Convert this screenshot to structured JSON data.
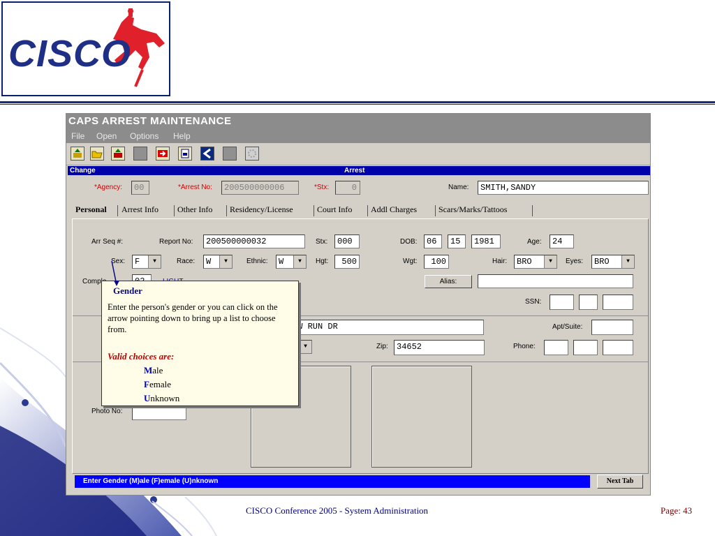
{
  "logo": {
    "text": "CISCO"
  },
  "window": {
    "title": "CAPS ARREST MAINTENANCE",
    "menu": [
      "File",
      "Open",
      "Options",
      "Help"
    ],
    "mode_left": "Change",
    "mode_right": "Arrest"
  },
  "header": {
    "agency_label": "*Agency:",
    "agency_value": "00",
    "arrest_no_label": "*Arrest No:",
    "arrest_no_value": "200500000006",
    "stx_label": "*Stx:",
    "stx_value": "0",
    "name_label": "Name:",
    "name_value": "SMITH,SANDY"
  },
  "tabs": [
    "Personal",
    "Arrest Info",
    "Other Info",
    "Residency/License",
    "Court Info",
    "Addl Charges",
    "Scars/Marks/Tattoos"
  ],
  "personal": {
    "arr_seq_label": "Arr Seq #:",
    "report_no_label": "Report No:",
    "report_no_value": "200500000032",
    "stx_label": "Stx:",
    "stx_value": "000",
    "dob_label": "DOB:",
    "dob_month": "06",
    "dob_day": "15",
    "dob_year": "1981",
    "age_label": "Age:",
    "age_value": "24",
    "sex_label": "Sex:",
    "sex_value": "F",
    "race_label": "Race:",
    "race_value": "W",
    "ethnic_label": "Ethnic:",
    "ethnic_value": "W",
    "hgt_label": "Hgt:",
    "hgt_value": "500",
    "wgt_label": "Wgt:",
    "wgt_value": "100",
    "hair_label": "Hair:",
    "hair_value": "BRO",
    "eyes_label": "Eyes:",
    "eyes_value": "BRO",
    "complexion_label": "Comple",
    "complexion_value": "02",
    "complexion_desc": "LIGHT",
    "alias_button": "Alias:",
    "ssn_label": "SSN:",
    "address_value": "OW RUN DR",
    "apt_label": "Apt/Suite:",
    "zip_label": "Zip:",
    "zip_value": "34652",
    "phone_label": "Phone:",
    "photo_no_label": "Photo No:"
  },
  "status": {
    "message": "Enter Gender (M)ale (F)emale (U)nknown",
    "next_tab": "Next Tab"
  },
  "tooltip": {
    "title": "Gender",
    "body": "Enter the person's gender or you can click on the arrow pointing down to bring up a list to choose from.",
    "valid_heading": "Valid choices are:",
    "options": [
      {
        "initial": "M",
        "rest": "ale"
      },
      {
        "initial": "F",
        "rest": "emale"
      },
      {
        "initial": "U",
        "rest": "nknown"
      }
    ]
  },
  "footer": {
    "center": "CISCO Conference 2005 - System Administration",
    "page": "Page: 43"
  },
  "colors": {
    "navy": "#1a2a80",
    "status_blue": "#0000ff",
    "red_label": "#d00000"
  }
}
